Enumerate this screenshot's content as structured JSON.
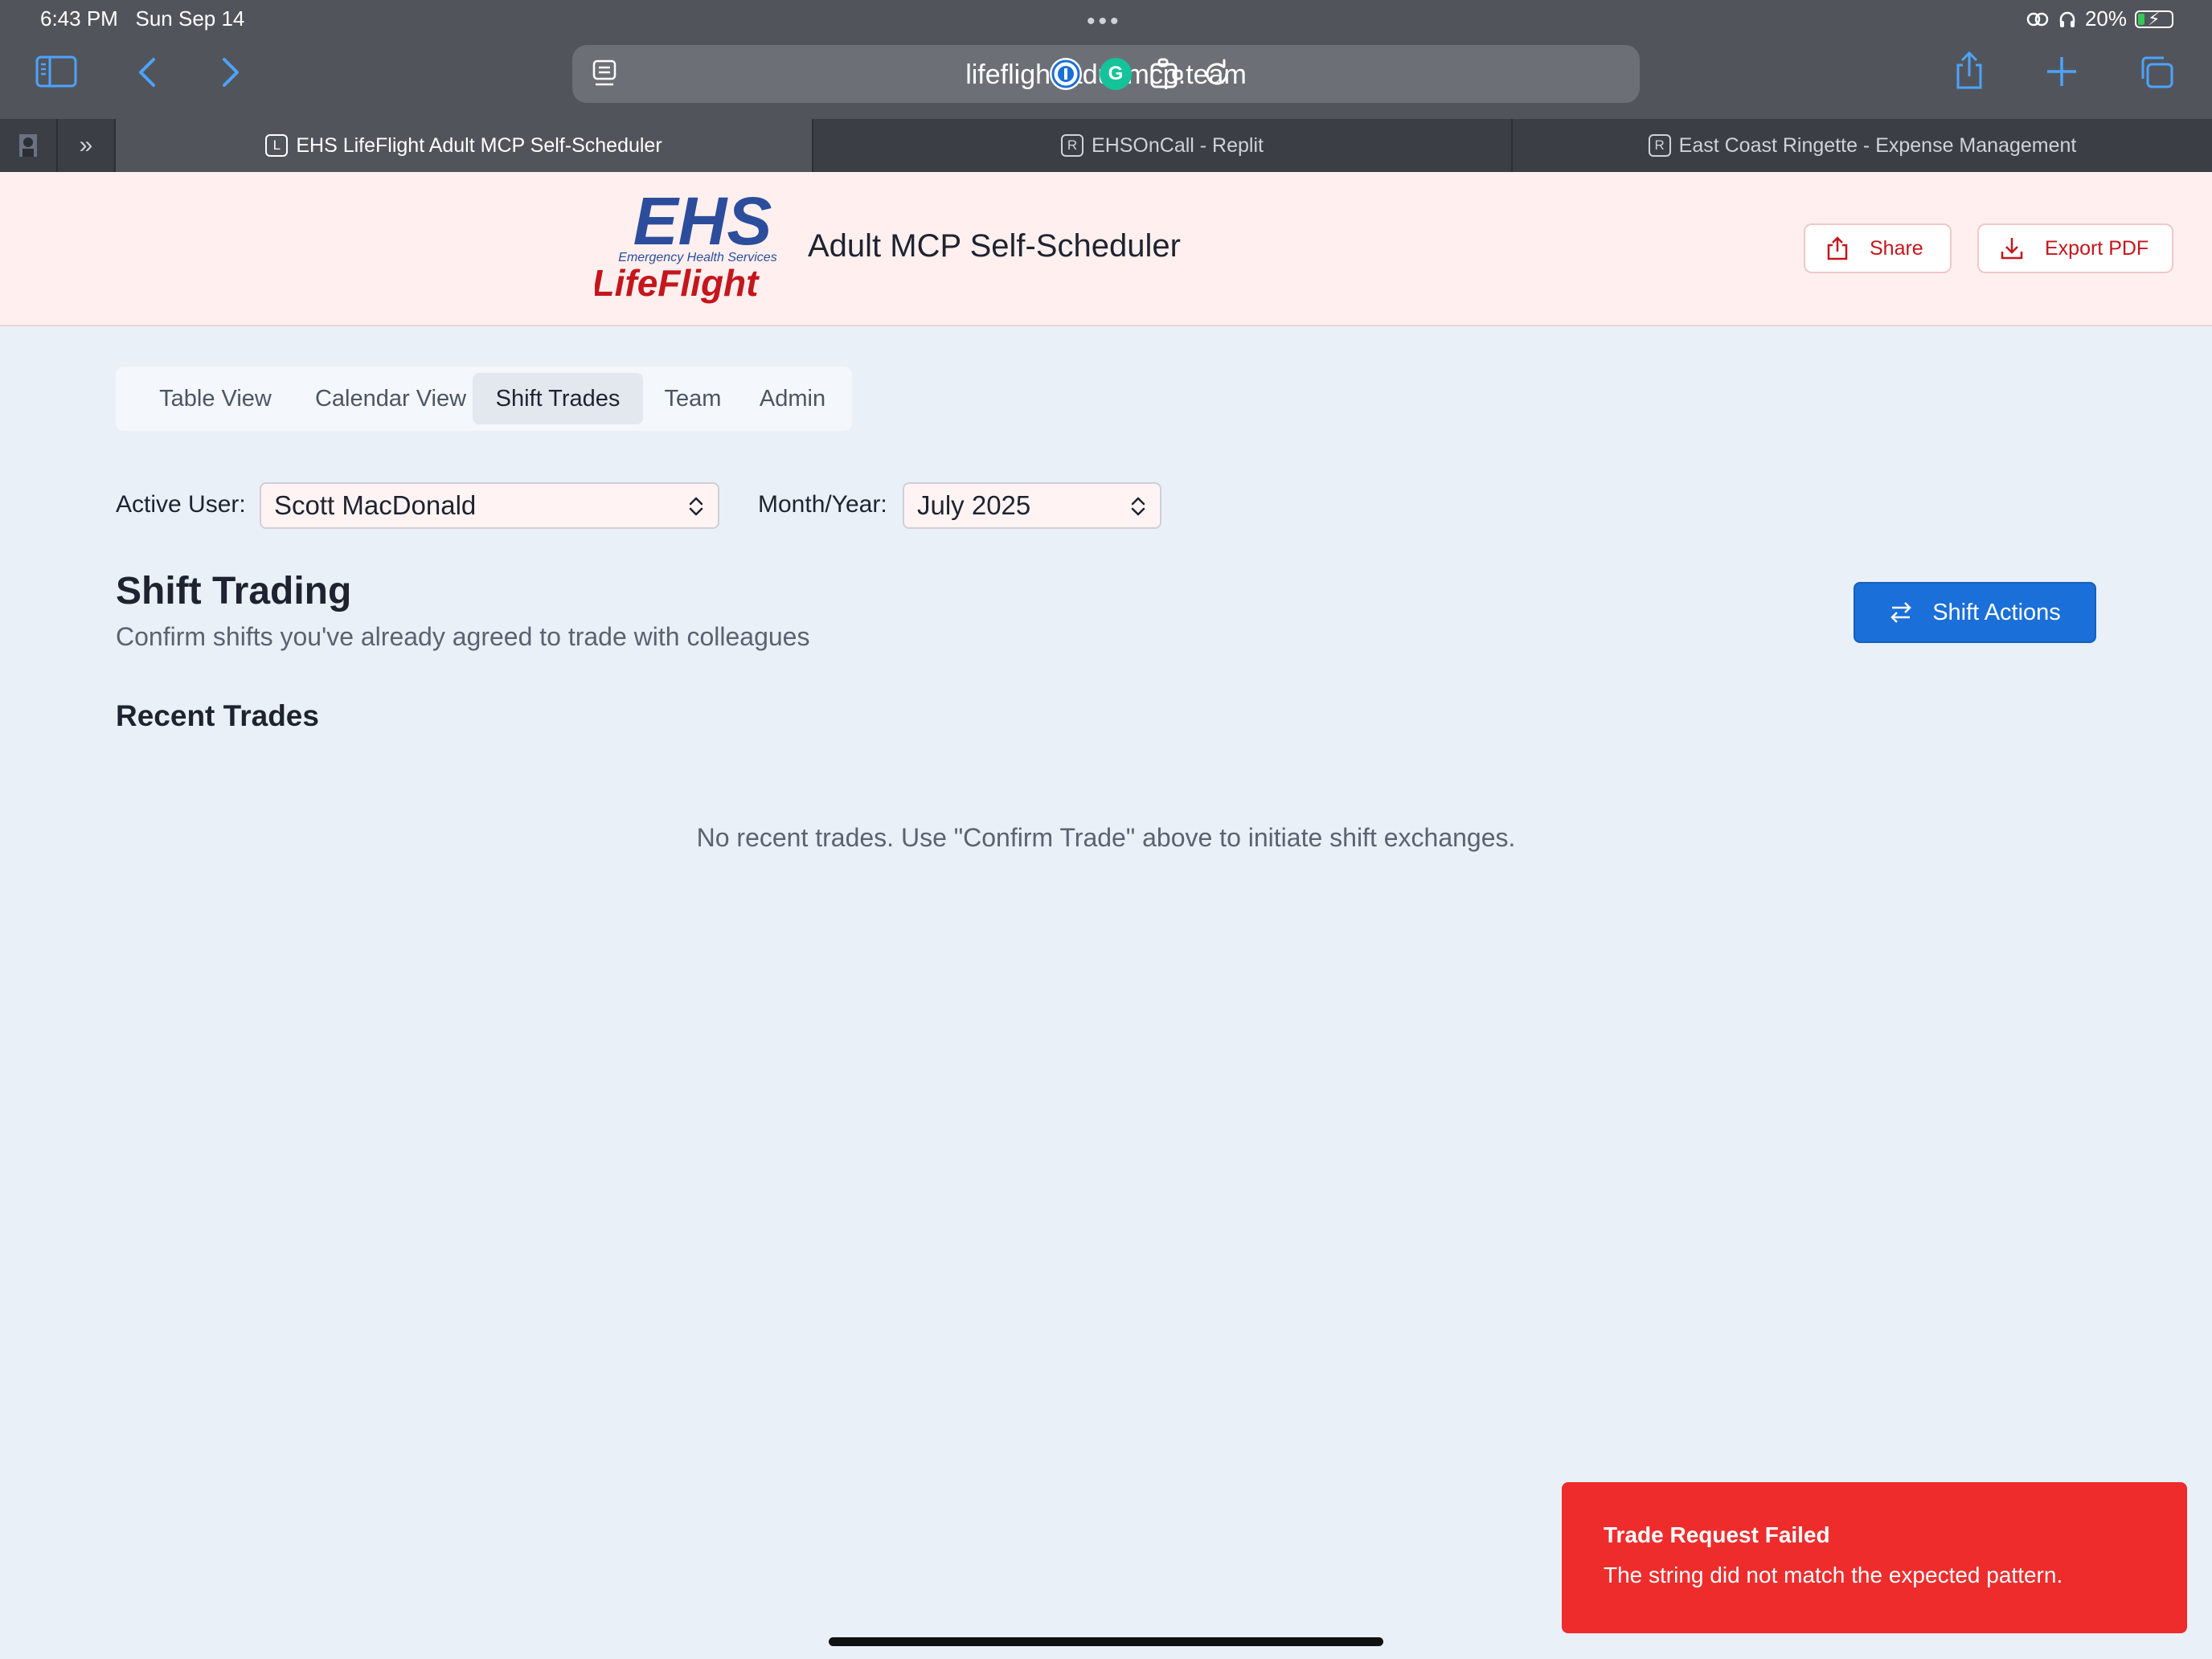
{
  "status_bar": {
    "time": "6:43 PM",
    "date": "Sun Sep 14",
    "battery": "20%",
    "battery_level": 0.2
  },
  "browser": {
    "url": "lifeflight-adultmcp.team",
    "icons": [
      "sidebar-icon",
      "back-icon",
      "forward-icon",
      "reader-icon",
      "password-manager-icon",
      "grammarly-icon",
      "extensions-icon",
      "reload-icon",
      "share-icon",
      "new-tab-icon",
      "tabs-overview-icon"
    ],
    "tabs": [
      {
        "favicon": "L",
        "title": "EHS LifeFlight Adult MCP Self-Scheduler",
        "active": true
      },
      {
        "favicon": "R",
        "title": "EHSOnCall - Replit",
        "active": false
      },
      {
        "favicon": "R",
        "title": "East Coast Ringette - Expense Management",
        "active": false
      }
    ]
  },
  "header": {
    "logo_text": {
      "top": "EHS",
      "middle": "Emergency Health Services",
      "bottom": "LifeFlight"
    },
    "title": "Adult MCP Self-Scheduler",
    "share_label": "Share",
    "export_label": "Export PDF"
  },
  "nav": {
    "tabs": [
      {
        "label": "Table View"
      },
      {
        "label": "Calendar View"
      },
      {
        "label": "Shift Trades",
        "active": true
      },
      {
        "label": "Team"
      },
      {
        "label": "Admin"
      }
    ]
  },
  "filters": {
    "user_label": "Active User:",
    "user_value": "Scott MacDonald",
    "month_label": "Month/Year:",
    "month_value": "July 2025"
  },
  "main": {
    "title": "Shift Trading",
    "subtitle": "Confirm shifts you've already agreed to trade with colleagues",
    "action_label": "Shift Actions",
    "recent_title": "Recent Trades",
    "empty_message": "No recent trades. Use \"Confirm Trade\" above to initiate shift exchanges."
  },
  "toast": {
    "title": "Trade Request Failed",
    "message": "The string did not match the expected pattern."
  },
  "colors": {
    "brand_blue": "#2c4d9c",
    "brand_red": "#c4161c",
    "primary": "#1a6fd8",
    "toast_bg": "#ee2c2c",
    "page_bg": "#e9f0f8",
    "header_bg": "#fff0ef"
  }
}
